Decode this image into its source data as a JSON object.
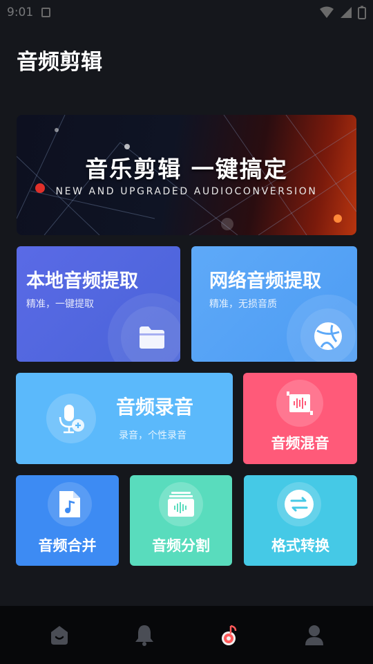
{
  "status_bar": {
    "time": "9:01"
  },
  "page": {
    "title": "音频剪辑"
  },
  "banner": {
    "title": "音乐剪辑  一键搞定",
    "subtitle": "NEW AND UPGRADED AUDIOCONVERSION"
  },
  "features": {
    "local_extract": {
      "title": "本地音频提取",
      "desc": "精准，一键提取",
      "icon": "folder-icon",
      "color": "#5b6fe3"
    },
    "network_extract": {
      "title": "网络音频提取",
      "desc": "精准，无损音质",
      "icon": "globe-icon",
      "color": "#5aa7f7"
    },
    "record": {
      "title": "音频录音",
      "desc": "录音，个性录音",
      "icon": "microphone-icon",
      "color": "#5bb9fb"
    },
    "mix": {
      "title": "音频混音",
      "icon": "waveform-icon",
      "color": "#ff5a79"
    },
    "merge": {
      "title": "音频合并",
      "icon": "music-file-icon",
      "color": "#3d8bf3"
    },
    "split": {
      "title": "音频分割",
      "icon": "split-icon",
      "color": "#59dcbd"
    },
    "convert": {
      "title": "格式转换",
      "icon": "convert-arrows-icon",
      "color": "#45c9e6"
    }
  },
  "bottom_nav": [
    {
      "name": "home",
      "icon": "home-icon"
    },
    {
      "name": "notifications",
      "icon": "bell-icon"
    },
    {
      "name": "audio",
      "icon": "music-note-icon",
      "active": true
    },
    {
      "name": "profile",
      "icon": "person-icon"
    }
  ]
}
